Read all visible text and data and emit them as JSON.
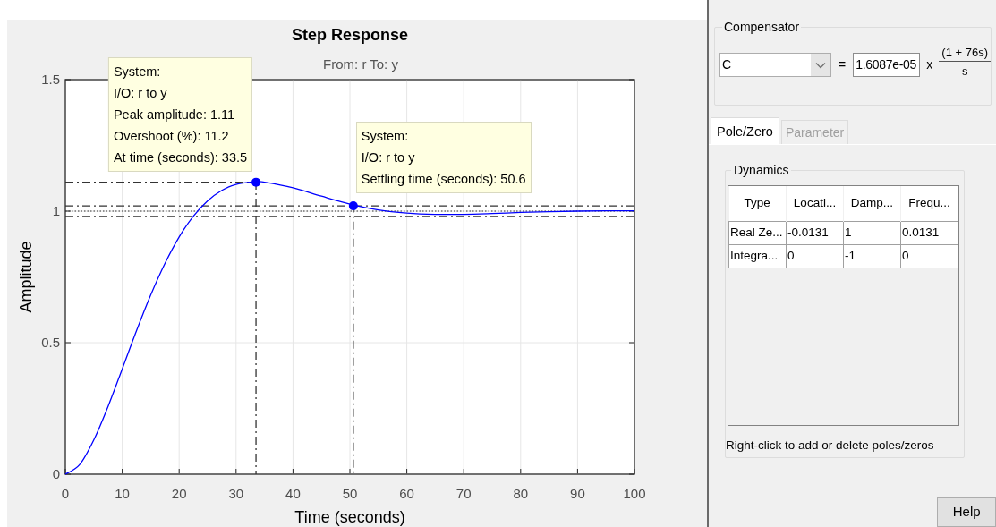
{
  "plot": {
    "subtitle": "From: r  To: y",
    "chart_data": {
      "type": "line",
      "title": "Step Response",
      "xlabel": "Time (seconds)",
      "ylabel": "Amplitude",
      "x": [
        0,
        2.5,
        5,
        7.5,
        10,
        12.5,
        15,
        17.5,
        20,
        22.5,
        25,
        27.5,
        30,
        33.5,
        35,
        40,
        45,
        50,
        55,
        60,
        65,
        70,
        75,
        80,
        85,
        90,
        95,
        100
      ],
      "series": [
        {
          "color": "#0000ff",
          "values": [
            0,
            0.036,
            0.13,
            0.257,
            0.4,
            0.545,
            0.681,
            0.801,
            0.902,
            0.981,
            1.039,
            1.079,
            1.102,
            1.112,
            1.11,
            1.089,
            1.057,
            1.027,
            1.005,
            0.993,
            0.988,
            0.988,
            0.991,
            0.995,
            0.998,
            1.0,
            1.001,
            1.001
          ]
        }
      ],
      "xlim": [
        0,
        100
      ],
      "ylim": [
        0,
        1.5
      ],
      "grid": true,
      "ref_lines": [
        {
          "axis": "y",
          "value": 1.11
        },
        {
          "axis": "x",
          "value": 33.5
        },
        {
          "axis": "y",
          "value": 1.02
        },
        {
          "axis": "y",
          "value": 0.98
        },
        {
          "axis": "y",
          "value": 1
        },
        {
          "axis": "x",
          "value": 50.6
        }
      ],
      "xticks": [
        0,
        10,
        20,
        30,
        40,
        50,
        60,
        70,
        80,
        90,
        100
      ],
      "yticks": [
        0,
        0.5,
        1,
        1.5
      ],
      "annotations": [
        {
          "x": 33.5,
          "y": 1.11,
          "text": "System:\nI/O: r to y\nPeak amplitude: 1.11\nOvershoot (%): 11.2\nAt time (seconds): 33.5"
        },
        {
          "x": 50.6,
          "y": 1.02,
          "text": "System:\nI/O: r to y\nSettling time (seconds): 50.6"
        }
      ]
    }
  },
  "compensator": {
    "title": "Compensator",
    "name": "C",
    "equals": "=",
    "gain": "1.6087e-05",
    "times": "x",
    "numerator": "(1 + 76s)",
    "denominator": "s"
  },
  "tabs": [
    {
      "label": "Pole/Zero",
      "selected": true,
      "disabled": false
    },
    {
      "label": "Parameter",
      "selected": false,
      "disabled": true
    }
  ],
  "dynamics": {
    "title": "Dynamics",
    "columns": [
      "Type",
      "Locati...",
      "Damp...",
      "Frequ..."
    ],
    "rows": [
      [
        "Real Ze...",
        "-0.0131",
        "1",
        "0.0131"
      ],
      [
        "Integra...",
        "0",
        "-1",
        "0"
      ]
    ],
    "hint": "Right-click to add or delete poles/zeros"
  },
  "buttons": [
    "Help"
  ]
}
